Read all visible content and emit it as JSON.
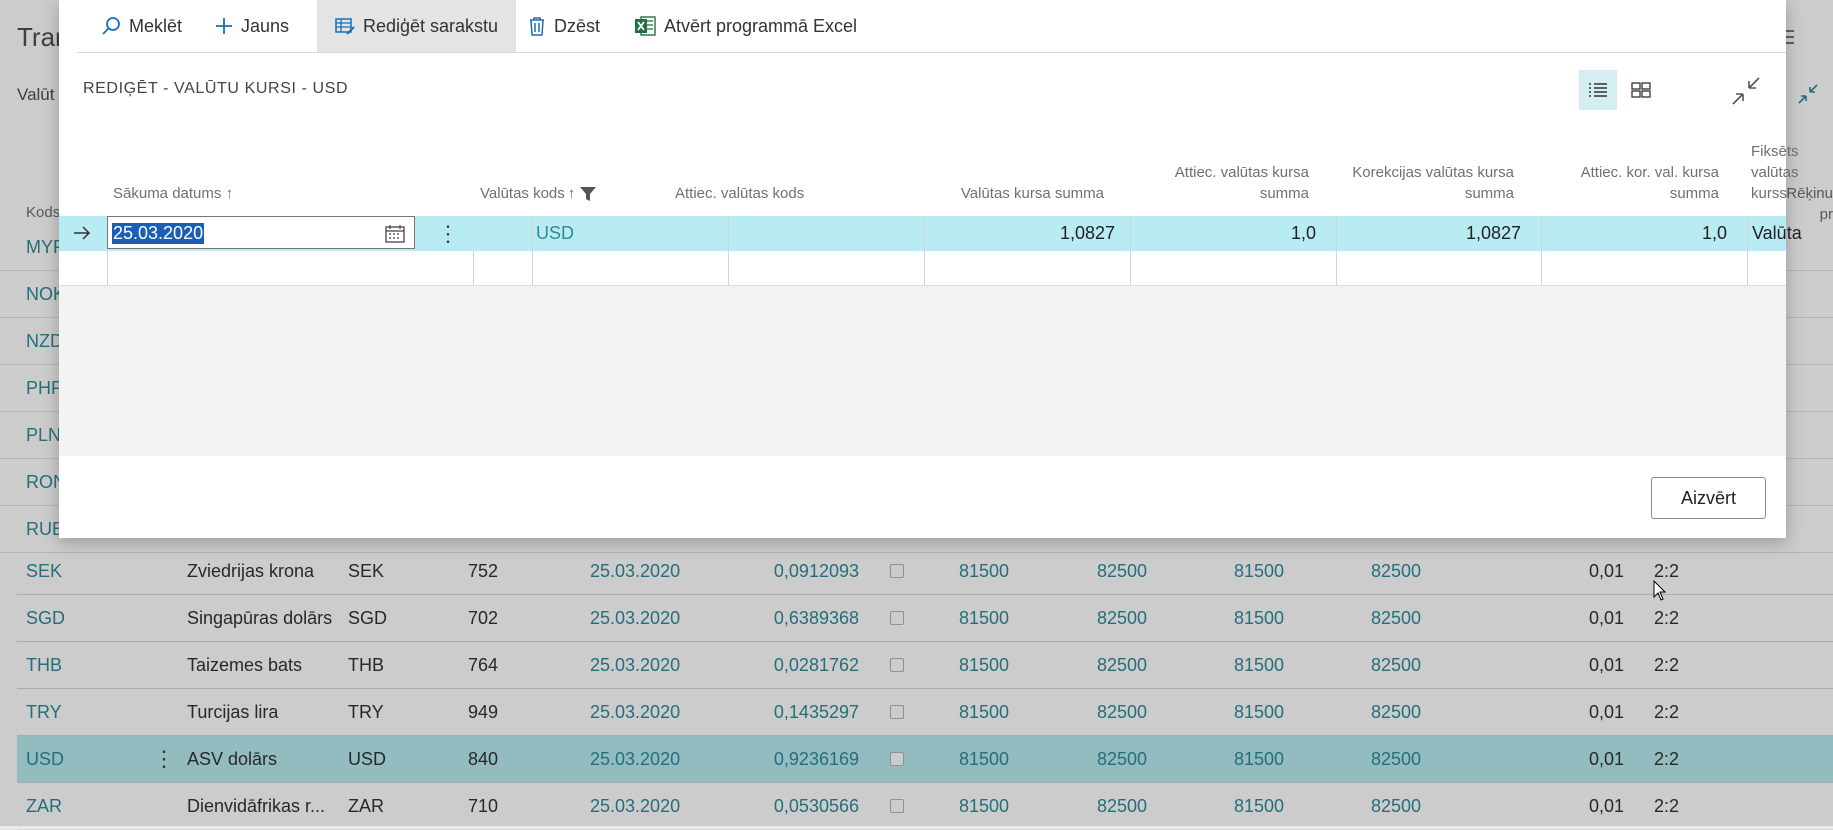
{
  "background": {
    "title": "Tran",
    "tab": "Valūt",
    "column_kods": "Kods",
    "column_rekinu": "Rēķinu pr",
    "codes_partial": [
      "MYR",
      "NOK",
      "NZD",
      "PHP",
      "PLN",
      "RON",
      "RUB"
    ],
    "rows": [
      {
        "code": "SEK",
        "name": "Zviedrijas krona",
        "iso": "SEK",
        "num": "752",
        "date": "25.03.2020",
        "rate": "0,0912093",
        "a1": "81500",
        "a2": "82500",
        "a3": "81500",
        "a4": "82500",
        "prec": "0,01",
        "ratio": "2:2",
        "selected": false
      },
      {
        "code": "SGD",
        "name": "Singapūras dolārs",
        "iso": "SGD",
        "num": "702",
        "date": "25.03.2020",
        "rate": "0,6389368",
        "a1": "81500",
        "a2": "82500",
        "a3": "81500",
        "a4": "82500",
        "prec": "0,01",
        "ratio": "2:2",
        "selected": false
      },
      {
        "code": "THB",
        "name": "Taizemes bats",
        "iso": "THB",
        "num": "764",
        "date": "25.03.2020",
        "rate": "0,0281762",
        "a1": "81500",
        "a2": "82500",
        "a3": "81500",
        "a4": "82500",
        "prec": "0,01",
        "ratio": "2:2",
        "selected": false
      },
      {
        "code": "TRY",
        "name": "Turcijas lira",
        "iso": "TRY",
        "num": "949",
        "date": "25.03.2020",
        "rate": "0,1435297",
        "a1": "81500",
        "a2": "82500",
        "a3": "81500",
        "a4": "82500",
        "prec": "0,01",
        "ratio": "2:2",
        "selected": false
      },
      {
        "code": "USD",
        "name": "ASV dolārs",
        "iso": "USD",
        "num": "840",
        "date": "25.03.2020",
        "rate": "0,9236169",
        "a1": "81500",
        "a2": "82500",
        "a3": "81500",
        "a4": "82500",
        "prec": "0,01",
        "ratio": "2:2",
        "selected": true
      },
      {
        "code": "ZAR",
        "name": "Dienvidāfrikas r...",
        "iso": "ZAR",
        "num": "710",
        "date": "25.03.2020",
        "rate": "0,0530566",
        "a1": "81500",
        "a2": "82500",
        "a3": "81500",
        "a4": "82500",
        "prec": "0,01",
        "ratio": "2:2",
        "selected": false
      }
    ]
  },
  "toolbar": {
    "search": "Meklēt",
    "new": "Jauns",
    "edit_list": "Rediģēt sarakstu",
    "delete": "Dzēst",
    "excel": "Atvērt programmā Excel"
  },
  "dialog": {
    "title": "REDIĢĒT - VALŪTU KURSI - USD",
    "close_button": "Aizvērt"
  },
  "columns": {
    "start_date": "Sākuma datums",
    "currency_code": "Valūtas kods",
    "relational_code": "Attiec. valūtas kods",
    "rate_amount": "Valūtas kursa summa",
    "rel_rate_amount_1": "Attiec. valūtas kursa",
    "rel_rate_amount_2": "summa",
    "adj_rate_amount_1": "Korekcijas valūtas kursa",
    "adj_rate_amount_2": "summa",
    "rel_adj_rate_amount_1": "Attiec. kor. val. kursa",
    "rel_adj_rate_amount_2": "summa",
    "fixed_1": "Fiksēts",
    "fixed_2": "valūtas",
    "fixed_3": "kurss"
  },
  "row": {
    "start_date": "25.03.2020",
    "currency_code": "USD",
    "relational_code": "",
    "rate_amount": "1,0827",
    "rel_rate_amount": "1,0",
    "adj_rate_amount": "1,0827",
    "rel_adj_rate_amount": "1,0",
    "fixed": "Valūta"
  },
  "colors": {
    "accent": "#2e8b9a",
    "selected_row": "#b8ecf2",
    "excel_green": "#1e7145"
  }
}
